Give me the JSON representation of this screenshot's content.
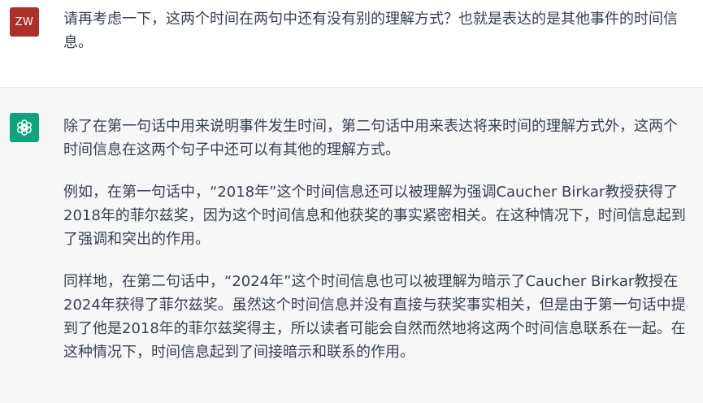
{
  "user_message": {
    "avatar_initials": "ZW",
    "text": "请再考虑一下，这两个时间在两句中还有没有别的理解方式？也就是表达的是其他事件的时间信息。"
  },
  "assistant_message": {
    "avatar_icon": "openai-logo-icon",
    "paragraphs": [
      "除了在第一句话中用来说明事件发生时间，第二句话中用来表达将来时间的理解方式外，这两个时间信息在这两个句子中还可以有其他的理解方式。",
      "例如，在第一句话中，“2018年”这个时间信息还可以被理解为强调Caucher Birkar教授获得了2018年的菲尔兹奖，因为这个时间信息和他获奖的事实紧密相关。在这种情况下，时间信息起到了强调和突出的作用。",
      "同样地，在第二句话中，“2024年”这个时间信息也可以被理解为暗示了Caucher Birkar教授在2024年获得了菲尔兹奖。虽然这个时间信息并没有直接与获奖事实相关，但是由于第一句话中提到了他是2018年的菲尔兹奖得主，所以读者可能会自然而然地将这两个时间信息联系在一起。在这种情况下，时间信息起到了间接暗示和联系的作用。"
    ]
  },
  "colors": {
    "user_avatar_bg": "#ad2f2a",
    "bot_avatar_bg": "#10a37f",
    "assistant_row_bg": "#f7f7f8",
    "text": "#374151"
  }
}
